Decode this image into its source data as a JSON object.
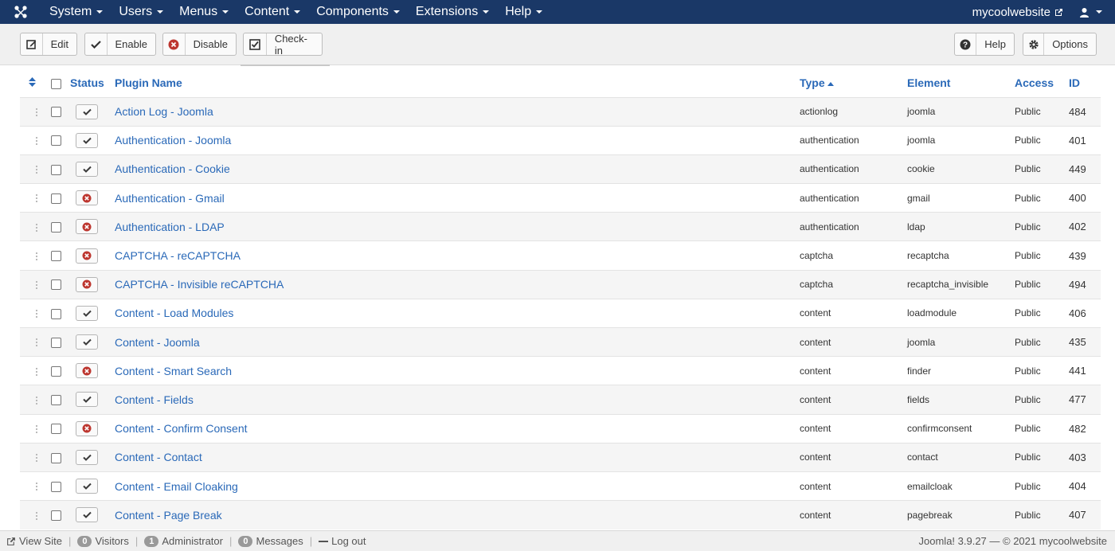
{
  "nav": {
    "items": [
      "System",
      "Users",
      "Menus",
      "Content",
      "Components",
      "Extensions",
      "Help"
    ],
    "site_name": "mycoolwebsite"
  },
  "toolbar": {
    "edit": "Edit",
    "enable": "Enable",
    "disable": "Disable",
    "checkin": "Check-in",
    "help": "Help",
    "options": "Options"
  },
  "table": {
    "headers": {
      "status": "Status",
      "name": "Plugin Name",
      "type": "Type",
      "element": "Element",
      "access": "Access",
      "id": "ID"
    },
    "rows": [
      {
        "name": "Action Log - Joomla",
        "enabled": true,
        "type": "actionlog",
        "element": "joomla",
        "access": "Public",
        "id": "484"
      },
      {
        "name": "Authentication - Joomla",
        "enabled": true,
        "type": "authentication",
        "element": "joomla",
        "access": "Public",
        "id": "401"
      },
      {
        "name": "Authentication - Cookie",
        "enabled": true,
        "type": "authentication",
        "element": "cookie",
        "access": "Public",
        "id": "449"
      },
      {
        "name": "Authentication - Gmail",
        "enabled": false,
        "type": "authentication",
        "element": "gmail",
        "access": "Public",
        "id": "400"
      },
      {
        "name": "Authentication - LDAP",
        "enabled": false,
        "type": "authentication",
        "element": "ldap",
        "access": "Public",
        "id": "402"
      },
      {
        "name": "CAPTCHA - reCAPTCHA",
        "enabled": false,
        "type": "captcha",
        "element": "recaptcha",
        "access": "Public",
        "id": "439"
      },
      {
        "name": "CAPTCHA - Invisible reCAPTCHA",
        "enabled": false,
        "type": "captcha",
        "element": "recaptcha_invisible",
        "access": "Public",
        "id": "494"
      },
      {
        "name": "Content - Load Modules",
        "enabled": true,
        "type": "content",
        "element": "loadmodule",
        "access": "Public",
        "id": "406"
      },
      {
        "name": "Content - Joomla",
        "enabled": true,
        "type": "content",
        "element": "joomla",
        "access": "Public",
        "id": "435"
      },
      {
        "name": "Content - Smart Search",
        "enabled": false,
        "type": "content",
        "element": "finder",
        "access": "Public",
        "id": "441"
      },
      {
        "name": "Content - Fields",
        "enabled": true,
        "type": "content",
        "element": "fields",
        "access": "Public",
        "id": "477"
      },
      {
        "name": "Content - Confirm Consent",
        "enabled": false,
        "type": "content",
        "element": "confirmconsent",
        "access": "Public",
        "id": "482"
      },
      {
        "name": "Content - Contact",
        "enabled": true,
        "type": "content",
        "element": "contact",
        "access": "Public",
        "id": "403"
      },
      {
        "name": "Content - Email Cloaking",
        "enabled": true,
        "type": "content",
        "element": "emailcloak",
        "access": "Public",
        "id": "404"
      },
      {
        "name": "Content - Page Break",
        "enabled": true,
        "type": "content",
        "element": "pagebreak",
        "access": "Public",
        "id": "407"
      }
    ]
  },
  "footer": {
    "view_site": "View Site",
    "visitors_count": "0",
    "visitors": "Visitors",
    "admin_count": "1",
    "administrator": "Administrator",
    "messages_count": "0",
    "messages": "Messages",
    "logout": "Log out",
    "version": "Joomla! 3.9.27 — © 2021 mycoolwebsite"
  },
  "colors": {
    "navbar": "#1a3867",
    "link": "#2a69b8",
    "enabled": "#3a3a3a",
    "disabled": "#bd362f"
  }
}
